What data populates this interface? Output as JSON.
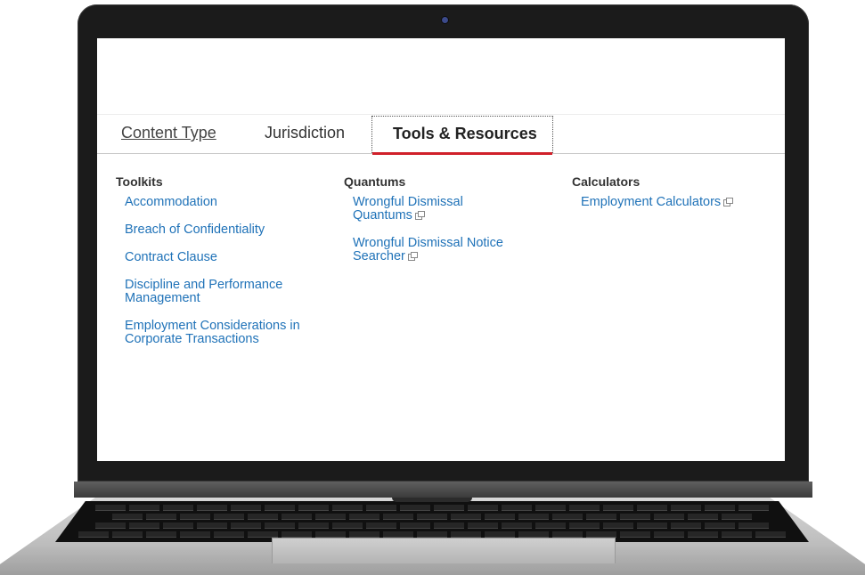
{
  "tabs": [
    {
      "label": "Content Type",
      "state": "link"
    },
    {
      "label": "Jurisdiction",
      "state": "default"
    },
    {
      "label": "Tools & Resources",
      "state": "active"
    }
  ],
  "columns": {
    "toolkits": {
      "heading": "Toolkits",
      "items": [
        "Accommodation",
        "Breach of Confidentiality",
        "Contract Clause",
        "Discipline and Performance Management",
        "Employment Considerations in Corporate Transactions"
      ]
    },
    "quantums": {
      "heading": "Quantums",
      "items": [
        {
          "label": "Wrongful Dismissal Quantums",
          "icon": "external-link-icon"
        },
        {
          "label": "Wrongful Dismissal Notice Searcher",
          "icon": "external-link-icon"
        }
      ]
    },
    "calculators": {
      "heading": "Calculators",
      "items": [
        {
          "label": "Employment Calculators",
          "icon": "external-link-icon"
        }
      ]
    }
  },
  "colors": {
    "link": "#1f72b8",
    "active_underline": "#d0202a",
    "text": "#333333"
  }
}
